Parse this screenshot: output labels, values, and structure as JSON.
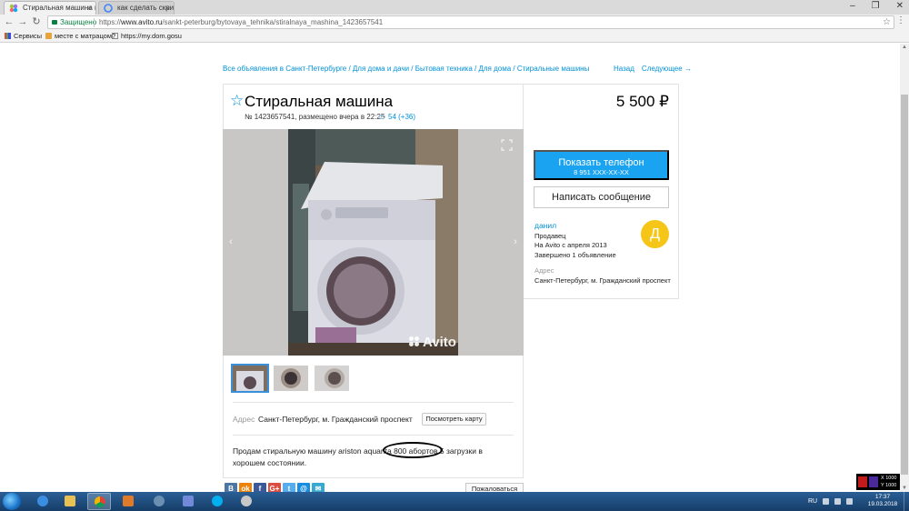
{
  "browser": {
    "tabs": [
      {
        "title": "Стиральная машина ку",
        "active": true
      },
      {
        "title": "как сделать скриншот",
        "active": false
      }
    ],
    "secure_label": "Защищено",
    "url_scheme": "https://",
    "url_host": "www.avito.ru",
    "url_path": "/sankt-peterburg/bytovaya_tehnika/stiralnaya_mashina_1423657541",
    "bookmarks": [
      "Сервисы",
      "месте с матрацом?",
      "https://my.dom.gosu"
    ]
  },
  "page": {
    "breadcrumb": "Все объявления в Санкт-Петербурге / Для дома и дачи / Бытовая техника / Для дома / Стиральные машины",
    "nav_back": "Назад",
    "nav_next": "Следующее →",
    "title": "Стиральная машина",
    "price": "5 500 ₽",
    "meta": "№ 1423657541, размещено вчера в 22:25",
    "views": "54 (+36)",
    "watermark": "Avito",
    "address_label": "Адрес",
    "address_value": "Санкт-Петербург, м. Гражданский проспект",
    "map_button": "Посмотреть карту",
    "description": "Продам стиральную машину ariston aquanta 800 абортов 5 загрузки в хорошем состоянии.",
    "complain_button": "Пожаловаться",
    "share_buttons": [
      "В",
      "ok",
      "f",
      "G+",
      "t",
      "@",
      "✉"
    ],
    "share_colors": [
      "#4c75a3",
      "#ee8208",
      "#3b5998",
      "#dc4e41",
      "#55acee",
      "#168de2",
      "#35a9d2"
    ]
  },
  "sidebar": {
    "phone_button": "Показать телефон",
    "phone_number": "8 951 XXX-XX-XX",
    "message_button": "Написать сообщение",
    "seller_name": "данил",
    "seller_role": "Продавец",
    "seller_since": "На Avito с апреля 2013",
    "seller_completed": "Завершено 1 объявление",
    "avatar_letter": "Д",
    "address_label": "Адрес",
    "address_value": "Санкт-Петербург, м. Гражданский проспект"
  },
  "overlay": {
    "x": "X 1000",
    "y": "Y 1000"
  },
  "taskbar": {
    "lang": "RU",
    "time": "17:37",
    "date": "19.03.2018"
  },
  "colors": {
    "accent": "#0091d9",
    "button_blue": "#1aa3f0",
    "avatar": "#f5c518"
  }
}
